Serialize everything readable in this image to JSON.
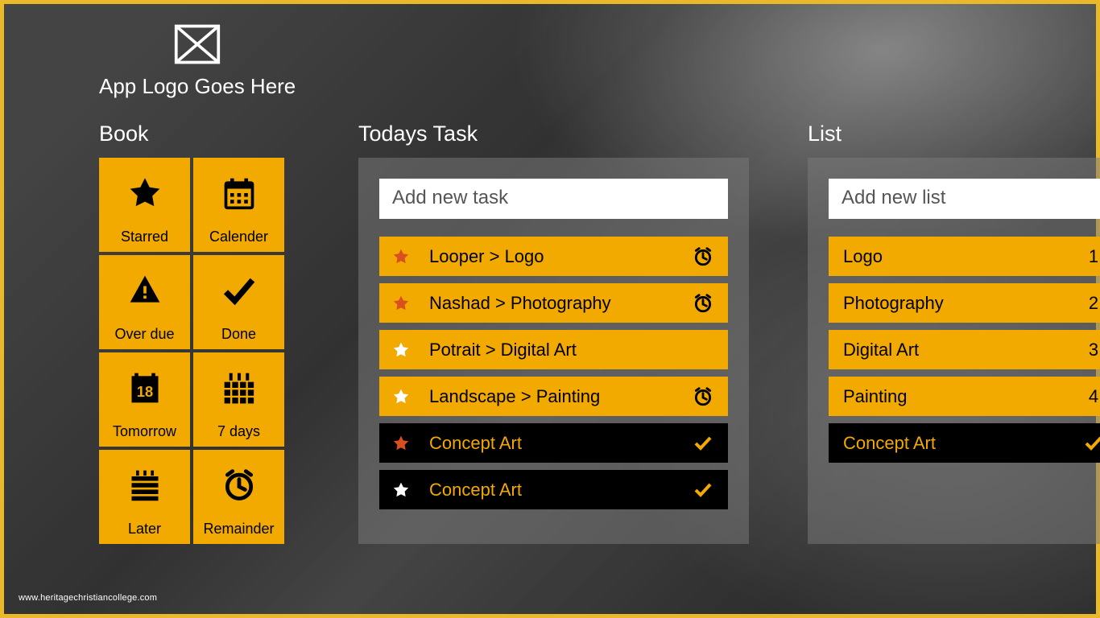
{
  "accent": "#f2a900",
  "header": {
    "title": "App Logo Goes Here"
  },
  "book": {
    "title": "Book",
    "tiles": [
      {
        "label": "Starred",
        "icon": "star-icon"
      },
      {
        "label": "Calender",
        "icon": "calendar-icon"
      },
      {
        "label": "Over due",
        "icon": "warning-icon"
      },
      {
        "label": "Done",
        "icon": "check-icon"
      },
      {
        "label": "Tomorrow",
        "icon": "calendar-18-icon"
      },
      {
        "label": "7 days",
        "icon": "week-icon"
      },
      {
        "label": "Later",
        "icon": "list-icon"
      },
      {
        "label": "Remainder",
        "icon": "alarm-icon"
      }
    ]
  },
  "today": {
    "title": "Todays Task",
    "input_placeholder": "Add new task",
    "tasks": [
      {
        "title": "Looper > Logo",
        "star": "red",
        "alarm": true,
        "done": false
      },
      {
        "title": "Nashad > Photography",
        "star": "red",
        "alarm": true,
        "done": false
      },
      {
        "title": "Potrait > Digital Art",
        "star": "white",
        "alarm": false,
        "done": false
      },
      {
        "title": "Landscape > Painting",
        "star": "white",
        "alarm": true,
        "done": false
      },
      {
        "title": "Concept Art",
        "star": "red",
        "alarm": false,
        "done": true
      },
      {
        "title": "Concept Art",
        "star": "white",
        "alarm": false,
        "done": true
      }
    ]
  },
  "list": {
    "title": "List",
    "input_placeholder": "Add new list",
    "items": [
      {
        "title": "Logo",
        "count": "1",
        "done": false
      },
      {
        "title": "Photography",
        "count": "2",
        "done": false
      },
      {
        "title": "Digital Art",
        "count": "3",
        "done": false
      },
      {
        "title": "Painting",
        "count": "4",
        "done": false
      },
      {
        "title": "Concept Art",
        "count": "",
        "done": true
      }
    ]
  },
  "watermark": "www.heritagechristiancollege.com"
}
